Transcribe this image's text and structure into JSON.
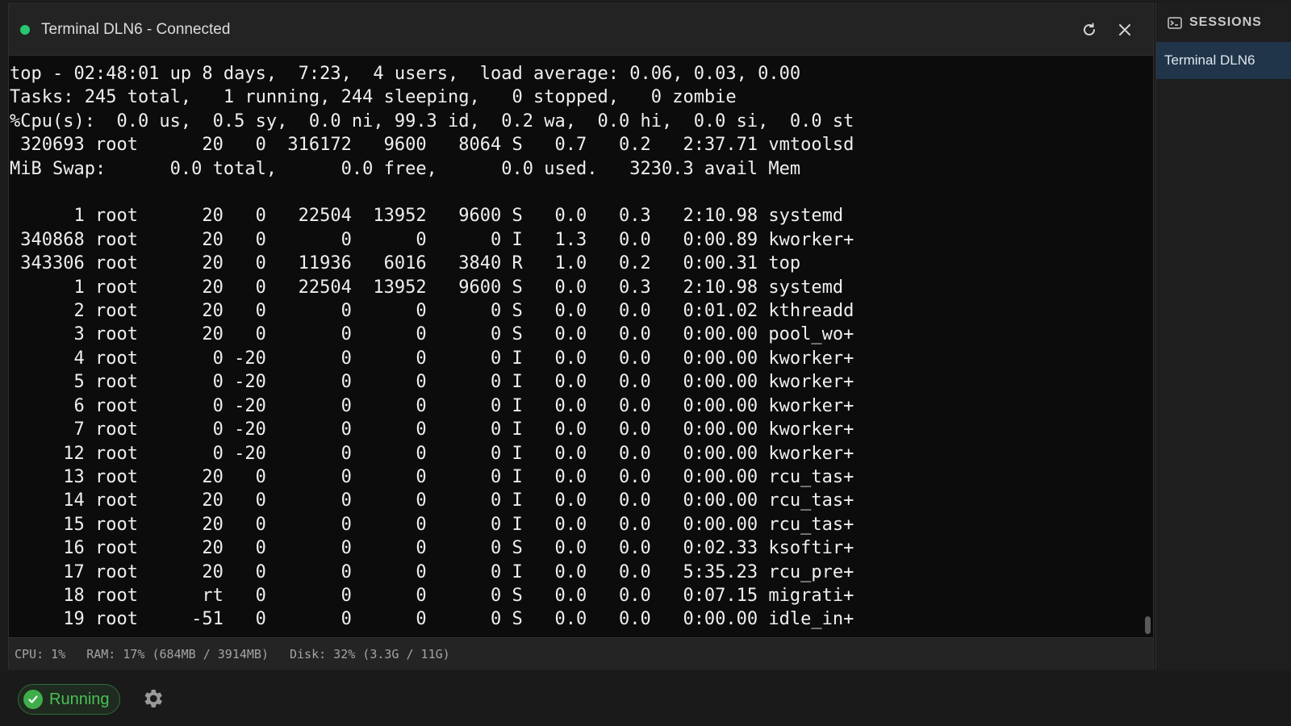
{
  "window": {
    "title": "Terminal DLN6 - Connected",
    "status_color": "#28c76f",
    "refresh_icon": "refresh-icon",
    "close_icon": "close-icon"
  },
  "terminal": {
    "lines": [
      "top - 02:48:01 up 8 days,  7:23,  4 users,  load average: 0.06, 0.03, 0.00",
      "Tasks: 245 total,   1 running, 244 sleeping,   0 stopped,   0 zombie",
      "%Cpu(s):  0.0 us,  0.5 sy,  0.0 ni, 99.3 id,  0.2 wa,  0.0 hi,  0.0 si,  0.0 st",
      " 320693 root      20   0  316172   9600   8064 S   0.7   0.2   2:37.71 vmtoolsd",
      "MiB Swap:      0.0 total,      0.0 free,      0.0 used.   3230.3 avail Mem",
      "",
      "      1 root      20   0   22504  13952   9600 S   0.0   0.3   2:10.98 systemd",
      " 340868 root      20   0       0      0      0 I   1.3   0.0   0:00.89 kworker+",
      " 343306 root      20   0   11936   6016   3840 R   1.0   0.2   0:00.31 top",
      "      1 root      20   0   22504  13952   9600 S   0.0   0.3   2:10.98 systemd",
      "      2 root      20   0       0      0      0 S   0.0   0.0   0:01.02 kthreadd",
      "      3 root      20   0       0      0      0 S   0.0   0.0   0:00.00 pool_wo+",
      "      4 root       0 -20       0      0      0 I   0.0   0.0   0:00.00 kworker+",
      "      5 root       0 -20       0      0      0 I   0.0   0.0   0:00.00 kworker+",
      "      6 root       0 -20       0      0      0 I   0.0   0.0   0:00.00 kworker+",
      "      7 root       0 -20       0      0      0 I   0.0   0.0   0:00.00 kworker+",
      "     12 root       0 -20       0      0      0 I   0.0   0.0   0:00.00 kworker+",
      "     13 root      20   0       0      0      0 I   0.0   0.0   0:00.00 rcu_tas+",
      "     14 root      20   0       0      0      0 I   0.0   0.0   0:00.00 rcu_tas+",
      "     15 root      20   0       0      0      0 I   0.0   0.0   0:00.00 rcu_tas+",
      "     16 root      20   0       0      0      0 S   0.0   0.0   0:02.33 ksoftir+",
      "     17 root      20   0       0      0      0 I   0.0   0.0   5:35.23 rcu_pre+",
      "     18 root      rt   0       0      0      0 S   0.0   0.0   0:07.15 migrati+",
      "     19 root     -51   0       0      0      0 S   0.0   0.0   0:00.00 idle_in+"
    ]
  },
  "statusline": {
    "cpu": "CPU: 1%",
    "ram": "RAM: 17% (684MB / 3914MB)",
    "disk": "Disk: 32% (3.3G / 11G)"
  },
  "sidebar": {
    "header": "SESSIONS",
    "header_icon": "terminal-icon",
    "items": [
      {
        "label": "Terminal DLN6",
        "active": true
      }
    ]
  },
  "bottombar": {
    "status_label": "Running",
    "status_color": "#49c155",
    "settings_icon": "gear-icon"
  }
}
